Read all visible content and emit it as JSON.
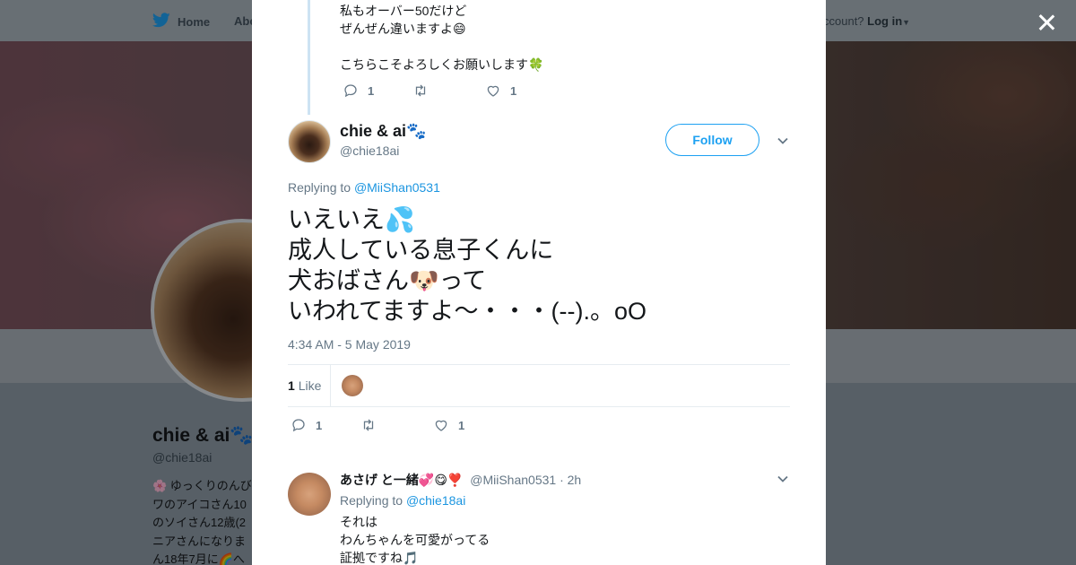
{
  "background_page": {
    "nav": {
      "home_label": "Home",
      "about_label": "Abo",
      "account_prompt": "ccount?",
      "login_label": "Log in"
    },
    "profile": {
      "name": "chie & ai",
      "name_emoji": "🐾",
      "handle": "@chie18ai",
      "bio_lines": [
        "🌸 ゆっくりのんび",
        "ワのアイコさん10",
        "のソイさん12歳(2",
        "ニアさんになりま",
        "ん18年7月に🌈へ"
      ]
    }
  },
  "modal": {
    "previous_tweet": {
      "lines": [
        "私もオーバー50だけど",
        "ぜんぜん違いますよ😄",
        "",
        "こちらこそよろしくお願いします🍀"
      ],
      "reply_count": "1",
      "retweet_count": "",
      "like_count": "1"
    },
    "main_tweet": {
      "author_name": "chie & ai",
      "author_emoji": "🐾",
      "author_handle": "@chie18ai",
      "follow_label": "Follow",
      "replying_to_prefix": "Replying to",
      "replying_to_user": "@MiiShan0531",
      "text_lines": [
        "いえいえ💦",
        "成人している息子くんに",
        "犬おばさん🐶って",
        "いわれてますよ〜・・・(--).。oO"
      ],
      "timestamp": "4:34 AM - 5 May 2019",
      "likes_number": "1",
      "likes_word": "Like",
      "reply_count": "1",
      "retweet_count": "",
      "like_count": "1"
    },
    "reply_tweet": {
      "author_name": "あさげ と一緒💞😋❣️",
      "author_handle": "@MiiShan0531",
      "time": "· 2h",
      "replying_to_prefix": "Replying to",
      "replying_to_user": "@chie18ai",
      "lines": [
        "それは",
        "わんちゃんを可愛がってる",
        "証拠ですね🎵"
      ]
    }
  },
  "colors": {
    "accent": "#1da1f2",
    "link": "#1b95e0",
    "muted_text": "#657786",
    "thread_line": "#cde3f3"
  }
}
